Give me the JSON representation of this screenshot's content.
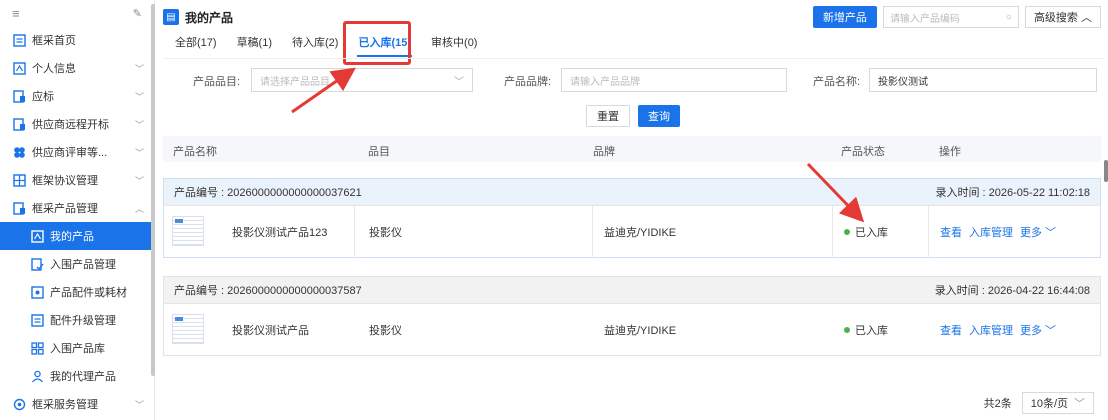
{
  "sidebar": {
    "items": [
      {
        "label": "框采首页",
        "icon": "doc-list-icon",
        "arrow": ""
      },
      {
        "label": "个人信息",
        "icon": "id-card-icon",
        "arrow": "﹀"
      },
      {
        "label": "应标",
        "icon": "doc-edit-icon",
        "arrow": "﹀"
      },
      {
        "label": "供应商远程开标",
        "icon": "doc-edit-icon",
        "arrow": "﹀"
      },
      {
        "label": "供应商评审等...",
        "icon": "cluster-icon",
        "arrow": "﹀"
      },
      {
        "label": "框架协议管理",
        "icon": "frame-icon",
        "arrow": "﹀"
      },
      {
        "label": "框采产品管理",
        "icon": "doc-edit-icon",
        "arrow": "︿"
      }
    ],
    "sub_items": [
      {
        "label": "我的产品",
        "icon": "id-card-icon"
      },
      {
        "label": "入围产品管理",
        "icon": "doc-check-icon"
      },
      {
        "label": "产品配件或耗材",
        "icon": "parts-icon"
      },
      {
        "label": "配件升级管理",
        "icon": "doc-list-icon"
      },
      {
        "label": "入围产品库",
        "icon": "grid-icon"
      },
      {
        "label": "我的代理产品",
        "icon": "user-icon"
      }
    ],
    "bottom_item": {
      "label": "框采服务管理",
      "arrow": "﹀"
    }
  },
  "header": {
    "title": "我的产品",
    "add_button": "新增产品",
    "search_placeholder": "请输入产品编码",
    "advanced_search": "高级搜索 ︿"
  },
  "tabs": [
    {
      "label": "全部(17)"
    },
    {
      "label": "草稿(1)"
    },
    {
      "label": "待入库(2)"
    },
    {
      "label": "已入库(15)"
    },
    {
      "label": "审核中(0)"
    }
  ],
  "filters": {
    "category_label": "产品品目:",
    "category_placeholder": "请选择产品品目",
    "brand_label": "产品品牌:",
    "brand_placeholder": "请输入产品品牌",
    "name_label": "产品名称:",
    "name_value": "投影仪测试"
  },
  "actions": {
    "reset": "重置",
    "query": "查询"
  },
  "table": {
    "headers": [
      "产品名称",
      "品目",
      "品牌",
      "产品状态",
      "操作"
    ],
    "rows": [
      {
        "code_label": "产品编号 : 2026000000000000037621",
        "time_label": "录入时间 : 2026-05-22 11:02:18",
        "name": "投影仪测试产品123",
        "category": "投影仪",
        "brand": "益迪克/YIDIKE",
        "status": "已入库",
        "ops": [
          "查看",
          "入库管理",
          "更多 ﹀"
        ]
      },
      {
        "code_label": "产品编号 : 2026000000000000037587",
        "time_label": "录入时间 : 2026-04-22 16:44:08",
        "name": "投影仪测试产品",
        "category": "投影仪",
        "brand": "益迪克/YIDIKE",
        "status": "已入库",
        "ops": [
          "查看",
          "入库管理",
          "更多 ﹀"
        ]
      }
    ]
  },
  "pagination": {
    "total": "共2条",
    "page_size": "10条/页"
  },
  "colors": {
    "accent": "#1a73e8",
    "highlight": "#e53935",
    "status_ok": "#4caf50"
  }
}
